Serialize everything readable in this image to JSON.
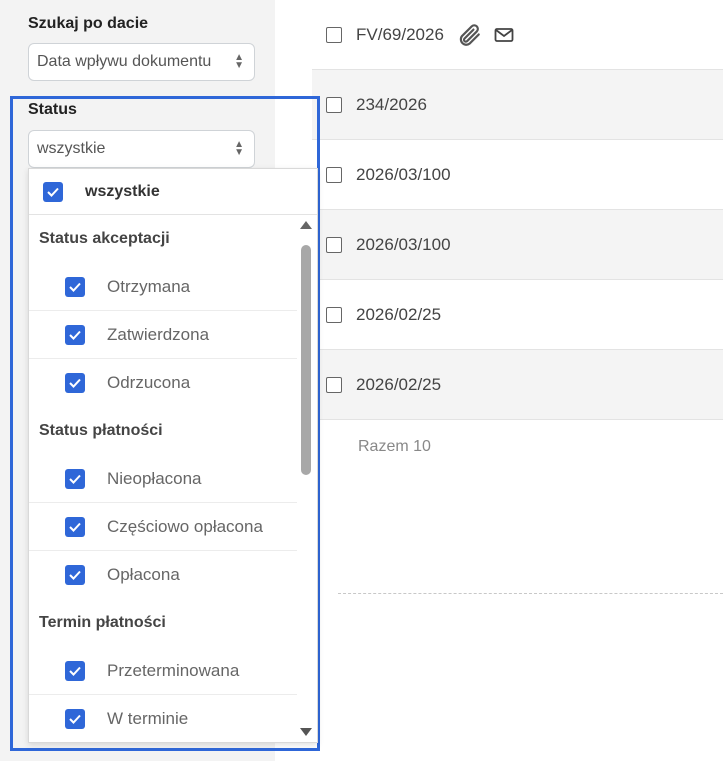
{
  "sidebar": {
    "date_search": {
      "label": "Szukaj po dacie",
      "value": "Data wpływu dokumentu"
    },
    "status": {
      "label": "Status",
      "value": "wszystkie"
    }
  },
  "status_dropdown": {
    "all_label": "wszystkie",
    "groups": [
      {
        "title": "Status akceptacji",
        "options": [
          "Otrzymana",
          "Zatwierdzona",
          "Odrzucona"
        ]
      },
      {
        "title": "Status płatności",
        "options": [
          "Nieopłacona",
          "Częściowo opłacona",
          "Opłacona"
        ]
      },
      {
        "title": "Termin płatności",
        "options": [
          "Przeterminowana",
          "W terminie"
        ]
      }
    ]
  },
  "documents": [
    {
      "number": "FV/69/2026",
      "icons": [
        "paperclip-icon",
        "envelope-icon"
      ]
    },
    {
      "number": "234/2026"
    },
    {
      "number": "2026/03/100"
    },
    {
      "number": "2026/03/100"
    },
    {
      "number": "2026/02/25"
    },
    {
      "number": "2026/02/25"
    }
  ],
  "total_label": "Razem 10",
  "colors": {
    "accent": "#2f67d8",
    "sidebar_bg": "#f3f3f3"
  }
}
